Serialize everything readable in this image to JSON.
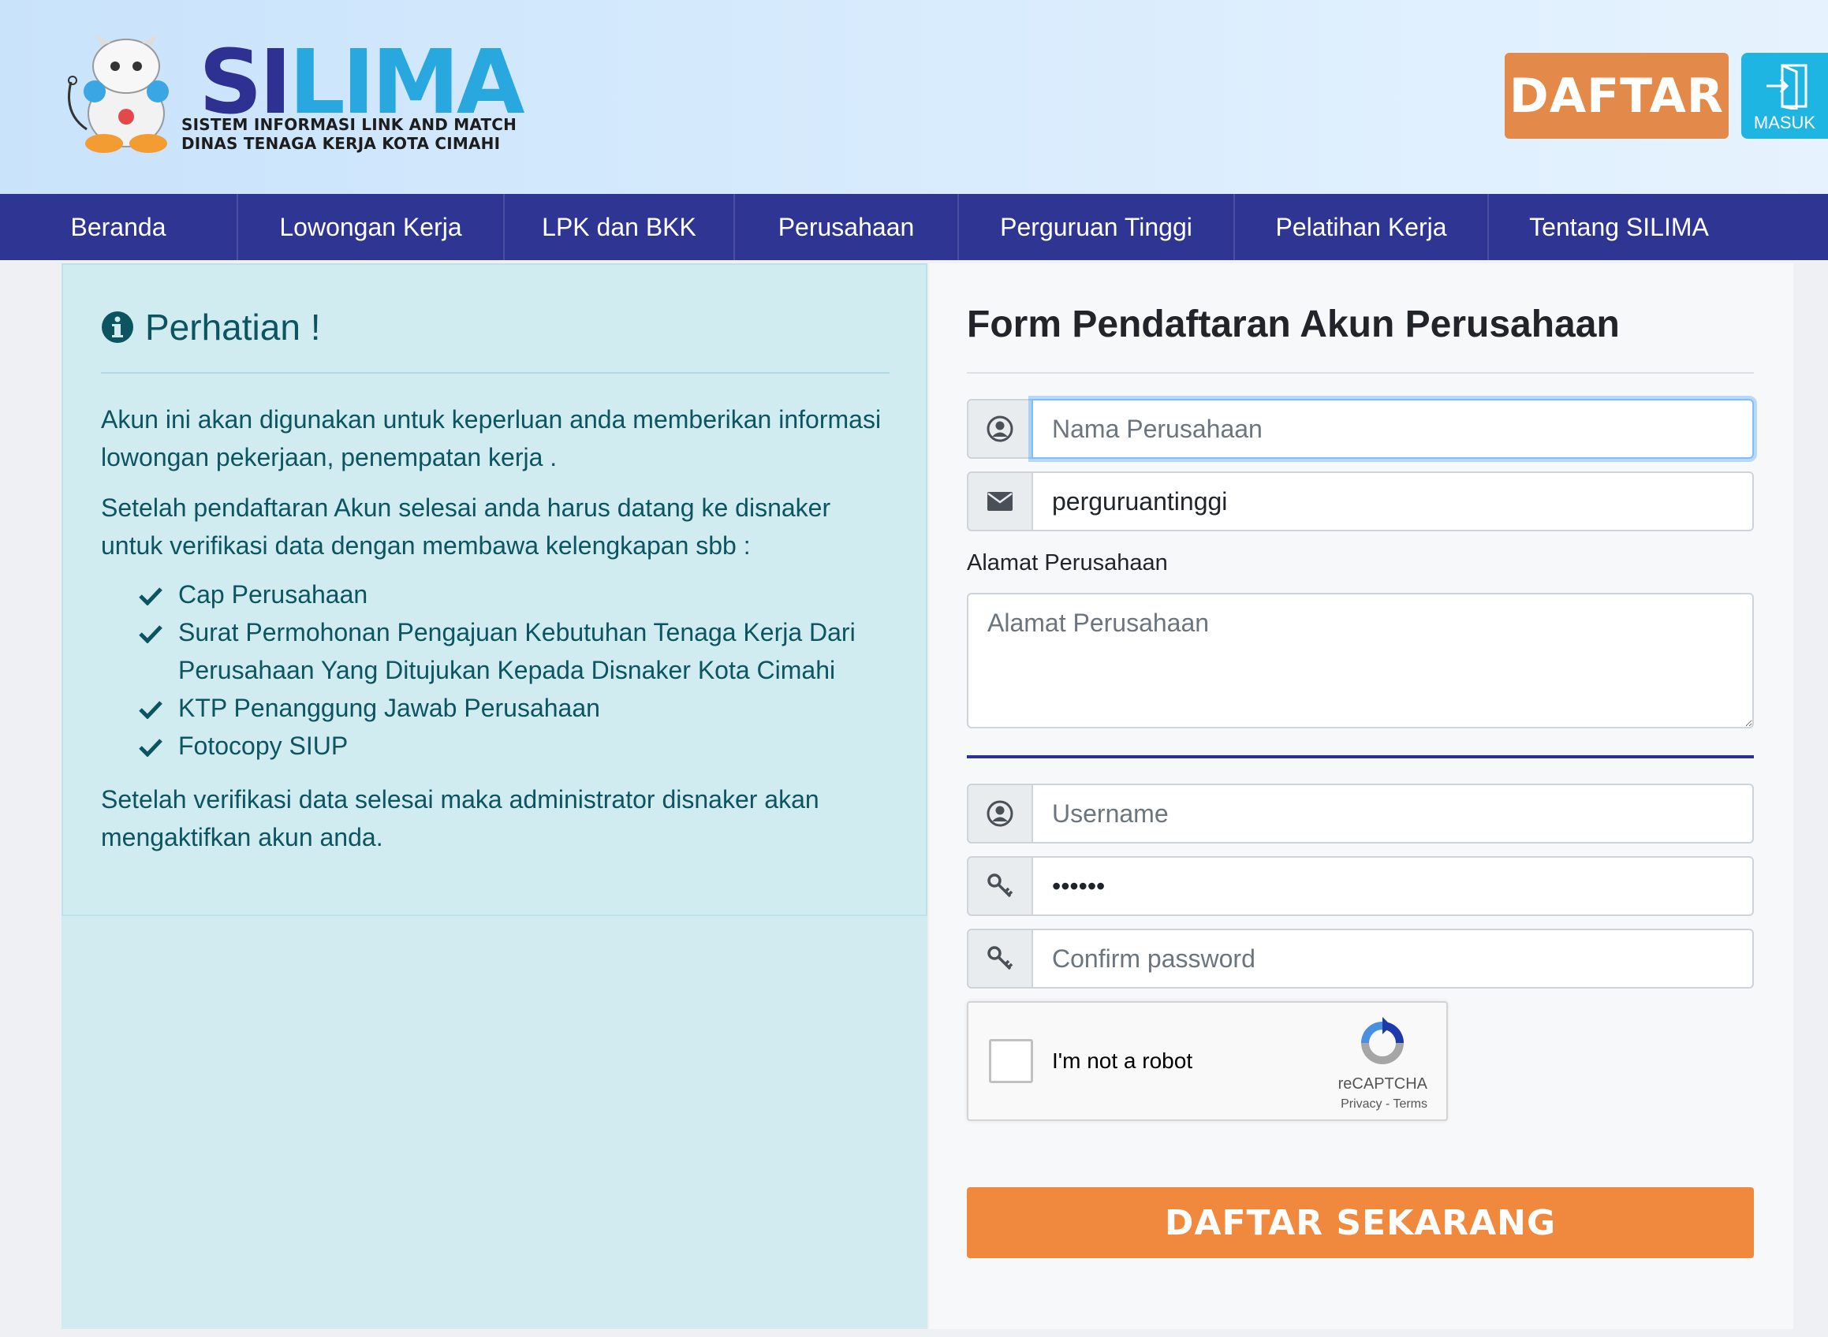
{
  "header": {
    "logo": {
      "title_si": "SI",
      "title_lima": "LIMA",
      "subtitle_line1": "SISTEM INFORMASI LINK AND MATCH",
      "subtitle_line2": "DINAS TENAGA KERJA KOTA CIMAHI"
    },
    "daftar_label": "DAFTAR",
    "masuk_label": "MASUK"
  },
  "nav": {
    "items": [
      {
        "label": "Beranda"
      },
      {
        "label": "Lowongan Kerja"
      },
      {
        "label": "LPK dan BKK"
      },
      {
        "label": "Perusahaan"
      },
      {
        "label": "Perguruan Tinggi"
      },
      {
        "label": "Pelatihan Kerja"
      },
      {
        "label": "Tentang SILIMA"
      }
    ]
  },
  "notice": {
    "title": "Perhatian !",
    "paragraph1": "Akun ini akan digunakan untuk keperluan anda memberikan informasi lowongan pekerjaan, penempatan kerja .",
    "paragraph2": "Setelah pendaftaran Akun selesai anda harus datang ke disnaker untuk verifikasi data dengan membawa kelengkapan sbb :",
    "requirements": [
      "Cap Perusahaan",
      "Surat Permohonan Pengajuan Kebutuhan Tenaga Kerja Dari Perusahaan Yang Ditujukan Kepada Disnaker Kota Cimahi",
      "KTP Penanggung Jawab Perusahaan",
      "Fotocopy SIUP"
    ],
    "paragraph3": "Setelah verifikasi data selesai maka administrator disnaker akan mengaktifkan akun anda."
  },
  "form": {
    "title": "Form Pendaftaran Akun Perusahaan",
    "company_name": {
      "placeholder": "Nama Perusahaan",
      "value": ""
    },
    "email": {
      "placeholder": "",
      "value": "perguruantinggi"
    },
    "address_label": "Alamat Perusahaan",
    "address": {
      "placeholder": "Alamat Perusahaan",
      "value": ""
    },
    "username": {
      "placeholder": "Username",
      "value": ""
    },
    "password": {
      "placeholder": "",
      "value": "123456"
    },
    "confirm_password": {
      "placeholder": "Confirm password",
      "value": ""
    },
    "recaptcha": {
      "label": "I'm not a robot",
      "brand": "reCAPTCHA",
      "links": "Privacy - Terms"
    },
    "submit_label": "DAFTAR SEKARANG"
  },
  "colors": {
    "nav_bg": "#2f3592",
    "daftar_bg": "#e3894a",
    "masuk_bg": "#1fb5e2",
    "notice_bg": "#d1ecf1",
    "notice_text": "#0c5460",
    "submit_bg": "#f0883e"
  }
}
